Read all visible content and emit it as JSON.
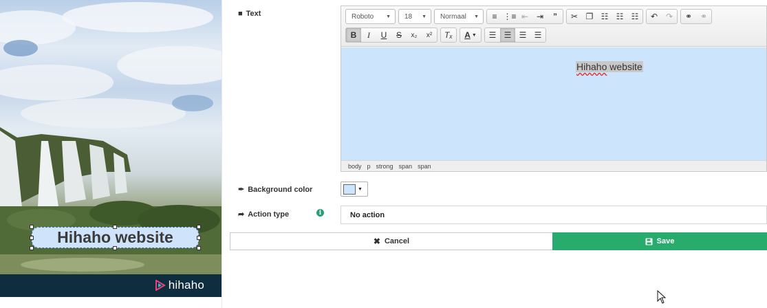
{
  "preview": {
    "hotspot_text": "Hihaho website",
    "brand_name": "hihaho"
  },
  "form": {
    "text_label": "Text",
    "background_color_label": "Background color",
    "action_type_label": "Action type"
  },
  "editor": {
    "font_family": "Roboto",
    "font_size": "18",
    "format": "Normaal",
    "content_text_part1": "Hihaho",
    "content_text_part2": " website",
    "path": [
      "body",
      "p",
      "strong",
      "span",
      "span"
    ]
  },
  "background_color": {
    "value": "#cce4fc"
  },
  "action_type": {
    "value": "No action"
  },
  "buttons": {
    "cancel": "Cancel",
    "save": "Save"
  },
  "colors": {
    "accent_green": "#2aab6e",
    "brand_bar": "#0e2d3f",
    "hotspot_fill": "#cfe3fb"
  }
}
